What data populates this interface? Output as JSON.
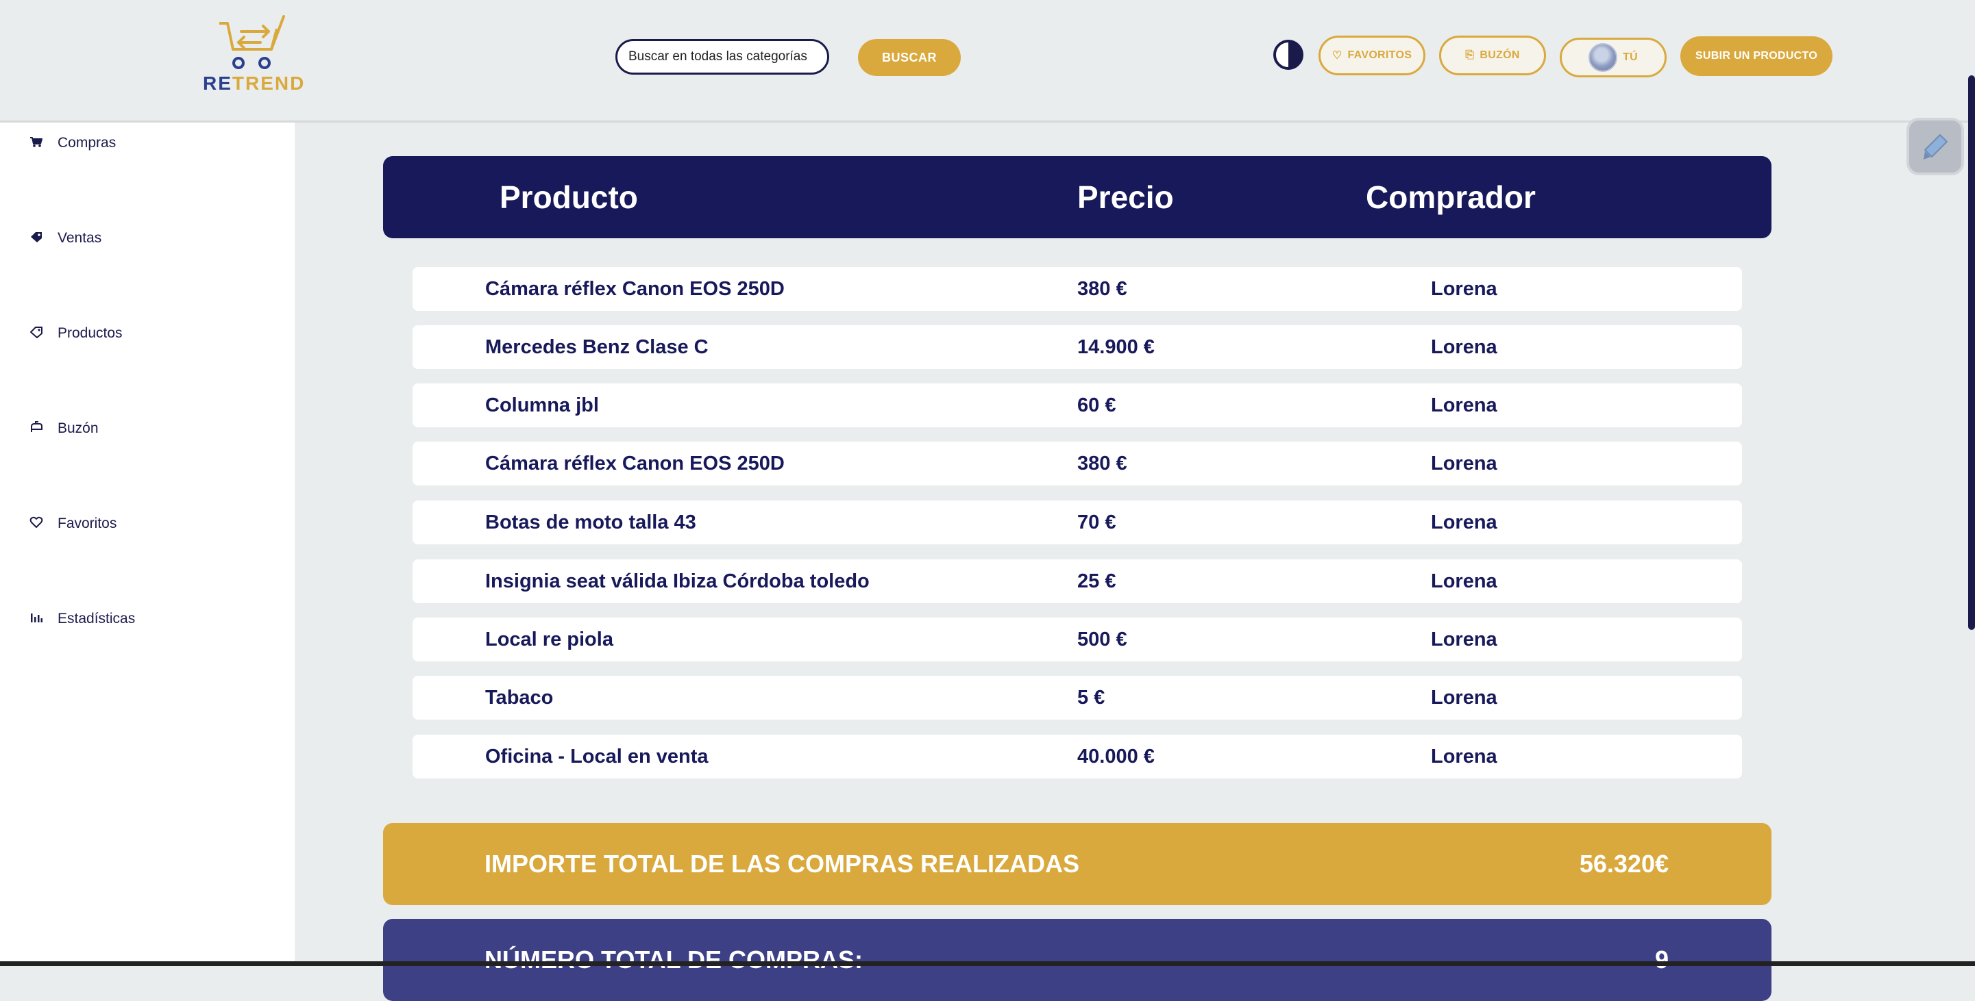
{
  "brand": {
    "logo_re": "RE",
    "logo_trend": "TREND"
  },
  "search": {
    "placeholder": "Buscar en todas las categorías",
    "button_label": "BUSCAR"
  },
  "nav": {
    "favoritos_label": "FAVORITOS",
    "buzon_label": "BUZÓN",
    "tu_label": "TÚ",
    "subir_label": "SUBIR UN PRODUCTO"
  },
  "sidebar": {
    "items": [
      {
        "label": "Compras",
        "icon": "cart-icon"
      },
      {
        "label": "Ventas",
        "icon": "tag-icon"
      },
      {
        "label": "Productos",
        "icon": "label-icon"
      },
      {
        "label": "Buzón",
        "icon": "mailbox-icon"
      },
      {
        "label": "Favoritos",
        "icon": "heart-icon"
      },
      {
        "label": "Estadísticas",
        "icon": "bar-chart-icon"
      }
    ]
  },
  "table": {
    "headers": {
      "product": "Producto",
      "price": "Precio",
      "buyer": "Comprador"
    },
    "rows": [
      {
        "product": "Cámara réflex Canon EOS 250D",
        "price": "380 €",
        "buyer": "Lorena"
      },
      {
        "product": "Mercedes Benz Clase C",
        "price": "14.900 €",
        "buyer": "Lorena"
      },
      {
        "product": "Columna jbl",
        "price": "60 €",
        "buyer": "Lorena"
      },
      {
        "product": "Cámara réflex Canon EOS 250D",
        "price": "380 €",
        "buyer": "Lorena"
      },
      {
        "product": "Botas de moto talla 43",
        "price": "70 €",
        "buyer": "Lorena"
      },
      {
        "product": "Insignia seat válida Ibiza Córdoba toledo",
        "price": "25 €",
        "buyer": "Lorena"
      },
      {
        "product": "Local re piola",
        "price": "500 €",
        "buyer": "Lorena"
      },
      {
        "product": "Tabaco",
        "price": "5 €",
        "buyer": "Lorena"
      },
      {
        "product": "Oficina - Local en venta",
        "price": "40.000 €",
        "buyer": "Lorena"
      }
    ]
  },
  "totals": {
    "amount_label": "IMPORTE TOTAL DE LAS COMPRAS REALIZADAS",
    "amount_value": "56.320€",
    "count_label": "NÚMERO TOTAL DE COMPRAS:",
    "count_value": "9"
  },
  "colors": {
    "navy": "#18195a",
    "gold": "#daa93e",
    "indigo": "#3e4086",
    "background": "#eaedee"
  }
}
